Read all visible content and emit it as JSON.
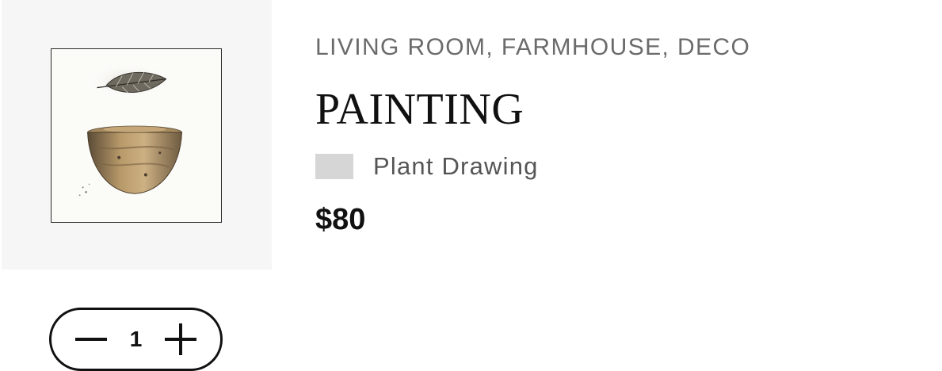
{
  "product": {
    "categories": "LIVING ROOM, FARMHOUSE, DECO",
    "title": "PAINTING",
    "variant": {
      "label": "Plant Drawing",
      "swatch_color": "#d6d6d6"
    },
    "price": "$80",
    "image": {
      "subject": "watercolor leaf above a wooden bowl"
    }
  },
  "quantity": {
    "value": "1",
    "decrement_icon": "minus-icon",
    "increment_icon": "plus-icon"
  },
  "colors": {
    "panel_bg": "#f6f6f6",
    "text_primary": "#111111",
    "text_muted": "#6b6b6b"
  }
}
